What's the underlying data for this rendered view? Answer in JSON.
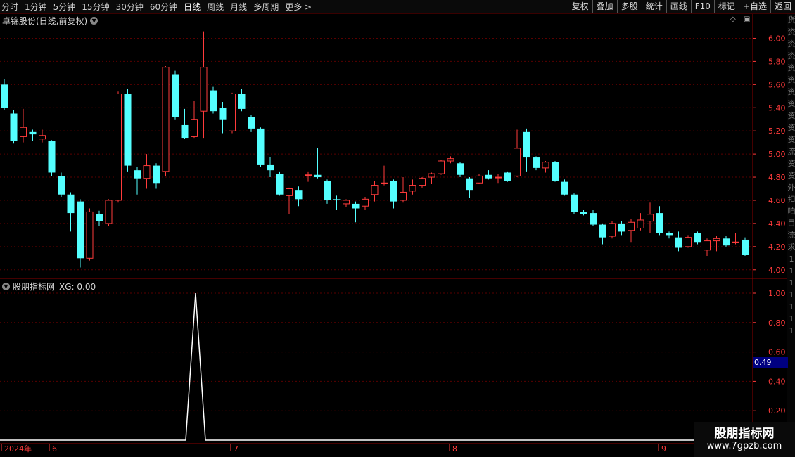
{
  "toolbar": {
    "periods": [
      "分时",
      "1分钟",
      "5分钟",
      "15分钟",
      "30分钟",
      "60分钟",
      "日线",
      "周线",
      "月线",
      "多周期",
      "更多"
    ],
    "active_period": "日线",
    "more_suffix": ">",
    "tools": [
      "复权",
      "叠加",
      "多股",
      "统计",
      "画线",
      "F10",
      "标记",
      "+自选",
      "返回"
    ]
  },
  "stock": {
    "title": "卓锦股份(日线,前复权)"
  },
  "price_axis": {
    "ticks": [
      "6.00",
      "5.80",
      "5.60",
      "5.40",
      "5.20",
      "5.00",
      "4.80",
      "4.60",
      "4.40",
      "4.20",
      "4.00"
    ]
  },
  "indicator": {
    "name": "股朋指标网",
    "xg_text": "XG: 0.00",
    "ticks": [
      "1.00",
      "0.80",
      "0.60",
      "0.40",
      "0.20"
    ],
    "current_value": "0.49"
  },
  "time_axis": {
    "labels": [
      "2024年",
      "6",
      "7",
      "8",
      "9"
    ]
  },
  "right_strip": {
    "chars": [
      "货",
      "资",
      "资",
      "资",
      "资",
      "资",
      "资",
      "资",
      "资",
      "资",
      "资",
      "流",
      "资",
      "资",
      "外",
      "扣",
      "咱",
      "目",
      "流",
      "求",
      "1",
      "1",
      "1",
      "1",
      "1",
      "1",
      "1"
    ]
  },
  "watermark": {
    "line1": "股朋指标网",
    "line2": "www.7gpzb.com"
  },
  "colors": {
    "up": "#ff3b3b",
    "down": "#54ffff",
    "axis": "#ff3b3b",
    "grid": "#5a0000",
    "indicator_line": "#ffffff"
  },
  "chart_data": {
    "type": "candlestick",
    "ylim": [
      3.95,
      6.1
    ],
    "candles": [
      [
        5.6,
        5.4,
        5.65,
        5.38
      ],
      [
        5.35,
        5.11,
        5.38,
        5.09
      ],
      [
        5.15,
        5.23,
        5.39,
        5.1
      ],
      [
        5.19,
        5.17,
        5.21,
        5.11
      ],
      [
        5.13,
        5.16,
        5.21,
        5.1
      ],
      [
        5.11,
        4.84,
        5.12,
        4.81
      ],
      [
        4.81,
        4.65,
        4.84,
        4.63
      ],
      [
        4.65,
        4.49,
        4.67,
        4.33
      ],
      [
        4.59,
        4.1,
        4.61,
        4.02
      ],
      [
        4.1,
        4.5,
        4.53,
        4.08
      ],
      [
        4.48,
        4.42,
        4.51,
        4.38
      ],
      [
        4.4,
        4.6,
        4.61,
        4.38
      ],
      [
        4.6,
        5.52,
        5.54,
        4.58
      ],
      [
        5.52,
        4.9,
        5.56,
        4.85
      ],
      [
        4.86,
        4.79,
        4.89,
        4.65
      ],
      [
        4.79,
        4.9,
        5.0,
        4.7
      ],
      [
        4.9,
        4.75,
        4.92,
        4.7
      ],
      [
        4.85,
        5.75,
        5.76,
        4.81
      ],
      [
        5.69,
        5.32,
        5.72,
        5.3
      ],
      [
        5.25,
        5.14,
        5.39,
        5.13
      ],
      [
        5.15,
        5.3,
        5.46,
        5.14
      ],
      [
        5.37,
        5.75,
        6.06,
        5.14
      ],
      [
        5.55,
        5.37,
        5.58,
        5.35
      ],
      [
        5.4,
        5.3,
        5.45,
        5.18
      ],
      [
        5.2,
        5.52,
        5.53,
        5.18
      ],
      [
        5.52,
        5.39,
        5.56,
        5.37
      ],
      [
        5.32,
        5.22,
        5.34,
        5.19
      ],
      [
        5.22,
        4.91,
        5.23,
        4.89
      ],
      [
        4.91,
        4.86,
        4.97,
        4.8
      ],
      [
        4.83,
        4.65,
        4.85,
        4.64
      ],
      [
        4.64,
        4.7,
        4.71,
        4.48
      ],
      [
        4.69,
        4.61,
        4.72,
        4.55
      ],
      [
        4.82,
        4.82,
        4.85,
        4.76
      ],
      [
        4.82,
        4.8,
        5.05,
        4.79
      ],
      [
        4.77,
        4.6,
        4.78,
        4.57
      ],
      [
        4.61,
        4.6,
        4.64,
        4.52
      ],
      [
        4.57,
        4.6,
        4.61,
        4.54
      ],
      [
        4.57,
        4.53,
        4.59,
        4.41
      ],
      [
        4.55,
        4.61,
        4.63,
        4.52
      ],
      [
        4.65,
        4.73,
        4.77,
        4.59
      ],
      [
        4.75,
        4.75,
        4.9,
        4.73
      ],
      [
        4.77,
        4.59,
        4.78,
        4.53
      ],
      [
        4.6,
        4.67,
        4.8,
        4.58
      ],
      [
        4.68,
        4.73,
        4.78,
        4.65
      ],
      [
        4.73,
        4.79,
        4.8,
        4.71
      ],
      [
        4.8,
        4.83,
        4.84,
        4.74
      ],
      [
        4.83,
        4.94,
        4.95,
        4.82
      ],
      [
        4.94,
        4.96,
        4.98,
        4.92
      ],
      [
        4.92,
        4.82,
        4.93,
        4.8
      ],
      [
        4.79,
        4.69,
        4.8,
        4.62
      ],
      [
        4.75,
        4.81,
        4.83,
        4.74
      ],
      [
        4.82,
        4.79,
        4.86,
        4.78
      ],
      [
        4.8,
        4.8,
        4.83,
        4.75
      ],
      [
        4.84,
        4.77,
        4.85,
        4.76
      ],
      [
        4.81,
        5.05,
        5.21,
        4.8
      ],
      [
        5.19,
        4.97,
        5.22,
        4.85
      ],
      [
        4.97,
        4.88,
        4.98,
        4.86
      ],
      [
        4.88,
        4.93,
        4.94,
        4.84
      ],
      [
        4.93,
        4.77,
        4.94,
        4.76
      ],
      [
        4.76,
        4.65,
        4.78,
        4.64
      ],
      [
        4.65,
        4.5,
        4.66,
        4.48
      ],
      [
        4.5,
        4.48,
        4.52,
        4.47
      ],
      [
        4.49,
        4.39,
        4.52,
        4.38
      ],
      [
        4.39,
        4.28,
        4.4,
        4.22
      ],
      [
        4.29,
        4.4,
        4.42,
        4.27
      ],
      [
        4.4,
        4.33,
        4.42,
        4.3
      ],
      [
        4.34,
        4.41,
        4.44,
        4.24
      ],
      [
        4.36,
        4.43,
        4.49,
        4.34
      ],
      [
        4.42,
        4.48,
        4.58,
        4.32
      ],
      [
        4.49,
        4.32,
        4.55,
        4.3
      ],
      [
        4.32,
        4.3,
        4.33,
        4.27
      ],
      [
        4.28,
        4.19,
        4.33,
        4.16
      ],
      [
        4.2,
        4.28,
        4.3,
        4.19
      ],
      [
        4.32,
        4.24,
        4.33,
        4.22
      ],
      [
        4.17,
        4.25,
        4.27,
        4.12
      ],
      [
        4.25,
        4.27,
        4.29,
        4.16
      ],
      [
        4.27,
        4.21,
        4.29,
        4.2
      ],
      [
        4.24,
        4.24,
        4.32,
        4.22
      ],
      [
        4.26,
        4.13,
        4.28,
        4.12
      ]
    ],
    "indicator_values": {
      "spike_index": 20,
      "spike_value": 1.0,
      "baseline": 0.0,
      "ylim": [
        0,
        1.0
      ]
    }
  }
}
